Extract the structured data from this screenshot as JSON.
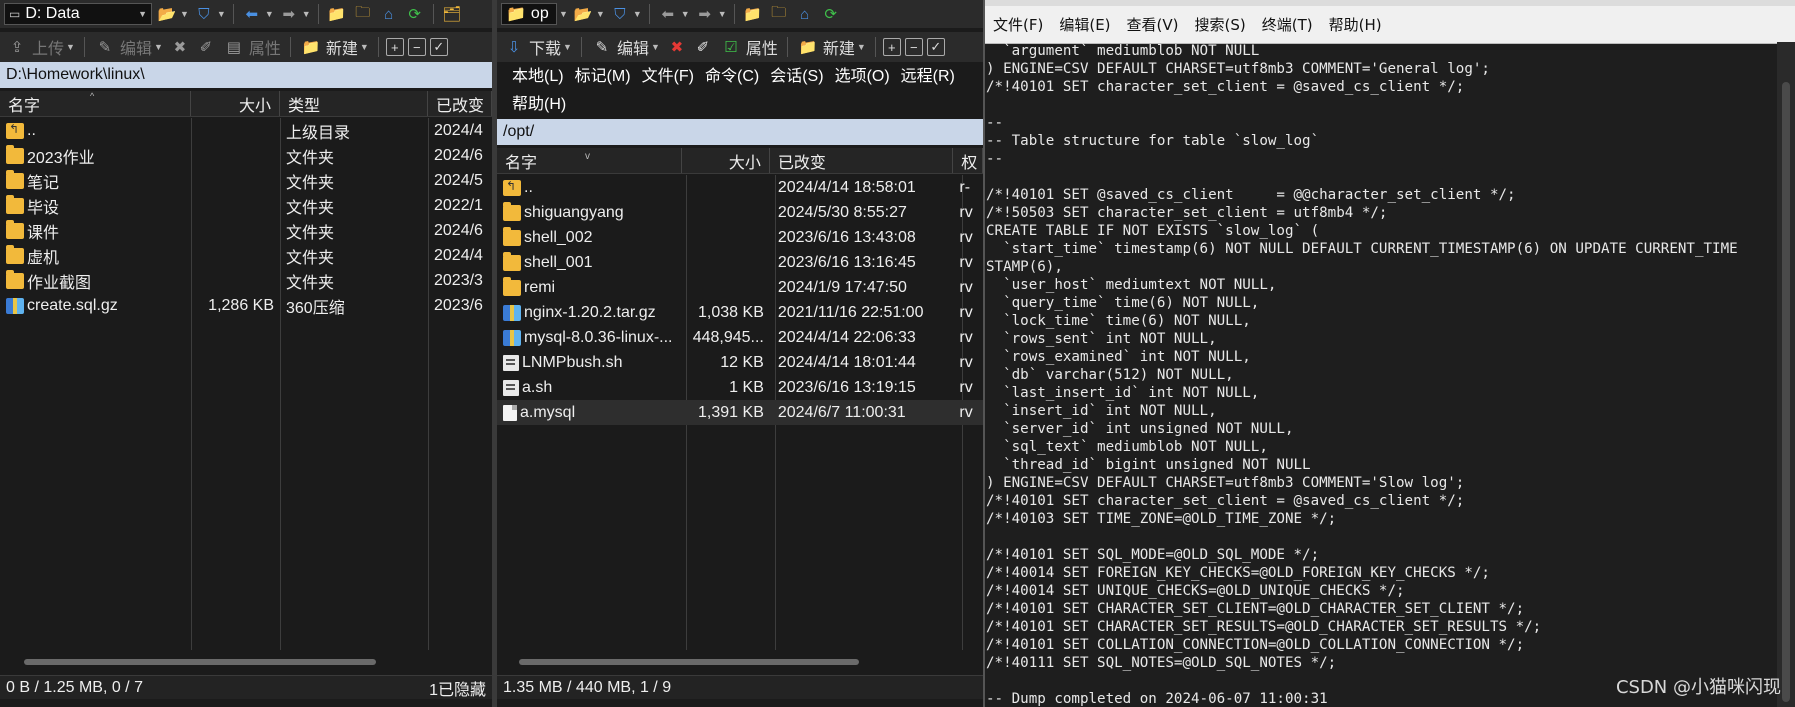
{
  "left": {
    "drive": "D: Data",
    "toolbar": {
      "upload": "上传",
      "edit": "编辑",
      "properties": "属性",
      "new": "新建"
    },
    "path": "D:\\Homework\\linux\\",
    "columns": {
      "name": "名字",
      "size": "大小",
      "type": "类型",
      "modified": "已改变"
    },
    "files": [
      {
        "name": "..",
        "size": "",
        "type": "上级目录",
        "modified": "2024/4",
        "icon": "updir"
      },
      {
        "name": "2023作业",
        "size": "",
        "type": "文件夹",
        "modified": "2024/6",
        "icon": "folder"
      },
      {
        "name": "笔记",
        "size": "",
        "type": "文件夹",
        "modified": "2024/5",
        "icon": "folder"
      },
      {
        "name": "毕设",
        "size": "",
        "type": "文件夹",
        "modified": "2022/1",
        "icon": "folder"
      },
      {
        "name": "课件",
        "size": "",
        "type": "文件夹",
        "modified": "2024/6",
        "icon": "folder"
      },
      {
        "name": "虚机",
        "size": "",
        "type": "文件夹",
        "modified": "2024/4",
        "icon": "folder"
      },
      {
        "name": "作业截图",
        "size": "",
        "type": "文件夹",
        "modified": "2023/3",
        "icon": "folder"
      },
      {
        "name": "create.sql.gz",
        "size": "1,286 KB",
        "type": "360压缩",
        "modified": "2023/6",
        "icon": "archive"
      }
    ],
    "status_left": "0 B / 1.25 MB,   0 / 7",
    "status_right": "1已隐藏"
  },
  "middle": {
    "drive": "op",
    "toolbar": {
      "download": "下载",
      "edit": "编辑",
      "properties": "属性",
      "new": "新建"
    },
    "menu": [
      "本地(L)",
      "标记(M)",
      "文件(F)",
      "命令(C)",
      "会话(S)",
      "选项(O)",
      "远程(R)",
      "帮助(H)"
    ],
    "path": "/opt/",
    "columns": {
      "name": "名字",
      "size": "大小",
      "modified": "已改变",
      "perm": "权"
    },
    "files": [
      {
        "name": "..",
        "size": "",
        "modified": "2024/4/14 18:58:01",
        "perm": "r-",
        "icon": "updir"
      },
      {
        "name": "shiguangyang",
        "size": "",
        "modified": "2024/5/30 8:55:27",
        "perm": "rv",
        "icon": "folder"
      },
      {
        "name": "shell_002",
        "size": "",
        "modified": "2023/6/16 13:43:08",
        "perm": "rv",
        "icon": "folder"
      },
      {
        "name": "shell_001",
        "size": "",
        "modified": "2023/6/16 13:16:45",
        "perm": "rv",
        "icon": "folder"
      },
      {
        "name": "remi",
        "size": "",
        "modified": "2024/1/9 17:47:50",
        "perm": "rv",
        "icon": "folder"
      },
      {
        "name": "nginx-1.20.2.tar.gz",
        "size": "1,038 KB",
        "modified": "2021/11/16 22:51:00",
        "perm": "rv",
        "icon": "archive"
      },
      {
        "name": "mysql-8.0.36-linux-...",
        "size": "448,945...",
        "modified": "2024/4/14 22:06:33",
        "perm": "rv",
        "icon": "archive"
      },
      {
        "name": "LNMPbush.sh",
        "size": "12 KB",
        "modified": "2024/4/14 18:01:44",
        "perm": "rv",
        "icon": "shell"
      },
      {
        "name": "a.sh",
        "size": "1 KB",
        "modified": "2023/6/16 13:19:15",
        "perm": "rv",
        "icon": "shell"
      },
      {
        "name": "a.mysql",
        "size": "1,391 KB",
        "modified": "2024/6/7 11:00:31",
        "perm": "rv",
        "icon": "doc"
      }
    ],
    "status_left": "1.35 MB / 440 MB,   1 / 9"
  },
  "terminal": {
    "menu": [
      "文件(F)",
      "编辑(E)",
      "查看(V)",
      "搜索(S)",
      "终端(T)",
      "帮助(H)"
    ],
    "lines": [
      "  `argument` mediumblob NOT NULL",
      ") ENGINE=CSV DEFAULT CHARSET=utf8mb3 COMMENT='General log';",
      "/*!40101 SET character_set_client = @saved_cs_client */;",
      "",
      "--",
      "-- Table structure for table `slow_log`",
      "--",
      "",
      "/*!40101 SET @saved_cs_client     = @@character_set_client */;",
      "/*!50503 SET character_set_client = utf8mb4 */;",
      "CREATE TABLE IF NOT EXISTS `slow_log` (",
      "  `start_time` timestamp(6) NOT NULL DEFAULT CURRENT_TIMESTAMP(6) ON UPDATE CURRENT_TIME",
      "STAMP(6),",
      "  `user_host` mediumtext NOT NULL,",
      "  `query_time` time(6) NOT NULL,",
      "  `lock_time` time(6) NOT NULL,",
      "  `rows_sent` int NOT NULL,",
      "  `rows_examined` int NOT NULL,",
      "  `db` varchar(512) NOT NULL,",
      "  `last_insert_id` int NOT NULL,",
      "  `insert_id` int NOT NULL,",
      "  `server_id` int unsigned NOT NULL,",
      "  `sql_text` mediumblob NOT NULL,",
      "  `thread_id` bigint unsigned NOT NULL",
      ") ENGINE=CSV DEFAULT CHARSET=utf8mb3 COMMENT='Slow log';",
      "/*!40101 SET character_set_client = @saved_cs_client */;",
      "/*!40103 SET TIME_ZONE=@OLD_TIME_ZONE */;",
      "",
      "/*!40101 SET SQL_MODE=@OLD_SQL_MODE */;",
      "/*!40014 SET FOREIGN_KEY_CHECKS=@OLD_FOREIGN_KEY_CHECKS */;",
      "/*!40014 SET UNIQUE_CHECKS=@OLD_UNIQUE_CHECKS */;",
      "/*!40101 SET CHARACTER_SET_CLIENT=@OLD_CHARACTER_SET_CLIENT */;",
      "/*!40101 SET CHARACTER_SET_RESULTS=@OLD_CHARACTER_SET_RESULTS */;",
      "/*!40101 SET COLLATION_CONNECTION=@OLD_COLLATION_CONNECTION */;",
      "/*!40111 SET SQL_NOTES=@OLD_SQL_NOTES */;",
      "",
      "-- Dump completed on 2024-06-07 11:00:31"
    ],
    "watermark": "CSDN @小猫咪闪现"
  }
}
